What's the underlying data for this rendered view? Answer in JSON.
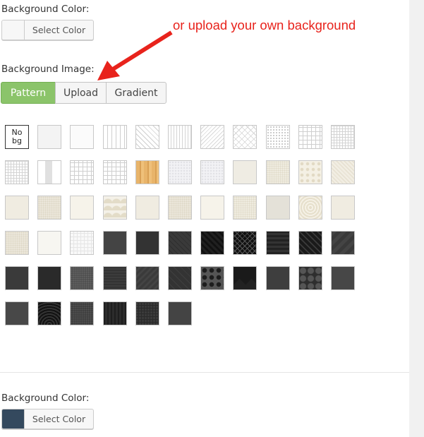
{
  "section_top": {
    "label": "Background Color:",
    "button_label": "Select Color",
    "swatch_color": "#f7f7f7"
  },
  "annotation": {
    "text": "or upload your own background",
    "color": "#e8231c"
  },
  "image_section": {
    "label": "Background Image:",
    "tabs": [
      {
        "label": "Pattern",
        "active": true
      },
      {
        "label": "Upload",
        "active": false
      },
      {
        "label": "Gradient",
        "active": false
      }
    ],
    "accent_color": "#8bc46a"
  },
  "patterns": {
    "no_bg_label": "No bg",
    "tiles": [
      "no-bg",
      "p-plain",
      "p-white",
      "p-vline",
      "p-diag",
      "p-vthin",
      "p-zig",
      "p-cross",
      "p-dots",
      "p-grid",
      "p-fgrid",
      "p-fgrid",
      "p-stripe",
      "p-grid",
      "p-grid",
      "p-wood",
      "p-lgray",
      "p-lgray",
      "p-beige",
      "p-beige2",
      "p-beigecirc",
      "p-beigediag",
      "p-beigeplain",
      "p-beigetex",
      "p-beigelight",
      "p-beigewave",
      "p-beigeplain",
      "p-beigetex",
      "p-beigelight",
      "p-beige2",
      "p-beigegray",
      "p-burst",
      "p-beigeplain",
      "p-beigetex",
      "p-offw",
      "p-wgrid",
      "p-dark1",
      "p-dark2",
      "p-dark3",
      "p-dark4",
      "p-dark5",
      "p-dark6",
      "p-dark7",
      "p-dark8",
      "p-dark9",
      "p-dark10",
      "p-dark11",
      "p-dark12",
      "p-dark13",
      "p-dark14",
      "p-dark15",
      "p-dark16",
      "p-dark17",
      "p-dark18",
      "p-dark19",
      "p-dark20",
      "p-dark21",
      "p-dark22",
      "p-dark23",
      "p-dark24",
      "p-dark25"
    ]
  },
  "section_bottom": {
    "label": "Background Color:",
    "button_label": "Select Color",
    "swatch_color": "#34495e"
  }
}
